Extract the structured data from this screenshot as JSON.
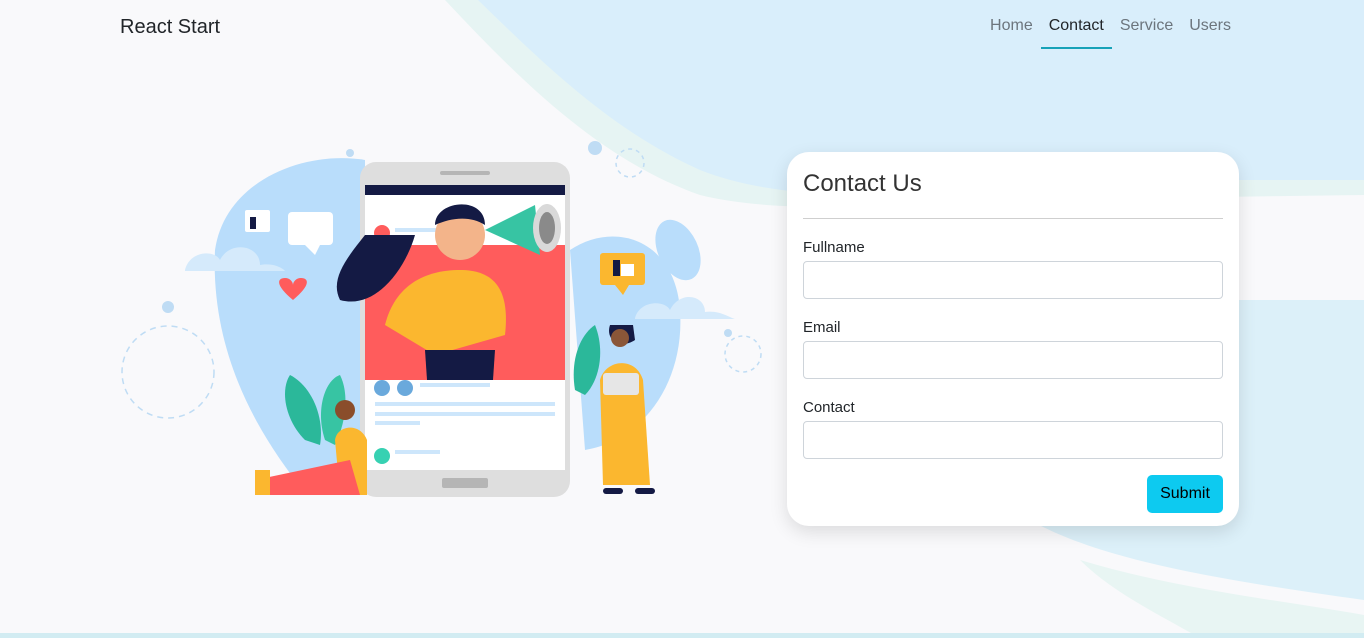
{
  "navbar": {
    "brand": "React Start",
    "links": [
      {
        "label": "Home",
        "active": false
      },
      {
        "label": "Contact",
        "active": true
      },
      {
        "label": "Service",
        "active": false
      },
      {
        "label": "Users",
        "active": false
      }
    ]
  },
  "contact_form": {
    "title": "Contact Us",
    "fields": [
      {
        "label": "Fullname",
        "value": "",
        "placeholder": ""
      },
      {
        "label": "Email",
        "value": "",
        "placeholder": ""
      },
      {
        "label": "Contact",
        "value": "",
        "placeholder": ""
      }
    ],
    "submit_label": "Submit"
  },
  "colors": {
    "accent": "#17a2b8",
    "submit": "#0dcaf0",
    "wave": "#d8eefb",
    "background": "#f9f9fb"
  },
  "icons": [
    "thumbs-up-icon",
    "speech-bubble-icon",
    "heart-icon",
    "megaphone-icon",
    "laptop-icon",
    "phone-icon"
  ]
}
